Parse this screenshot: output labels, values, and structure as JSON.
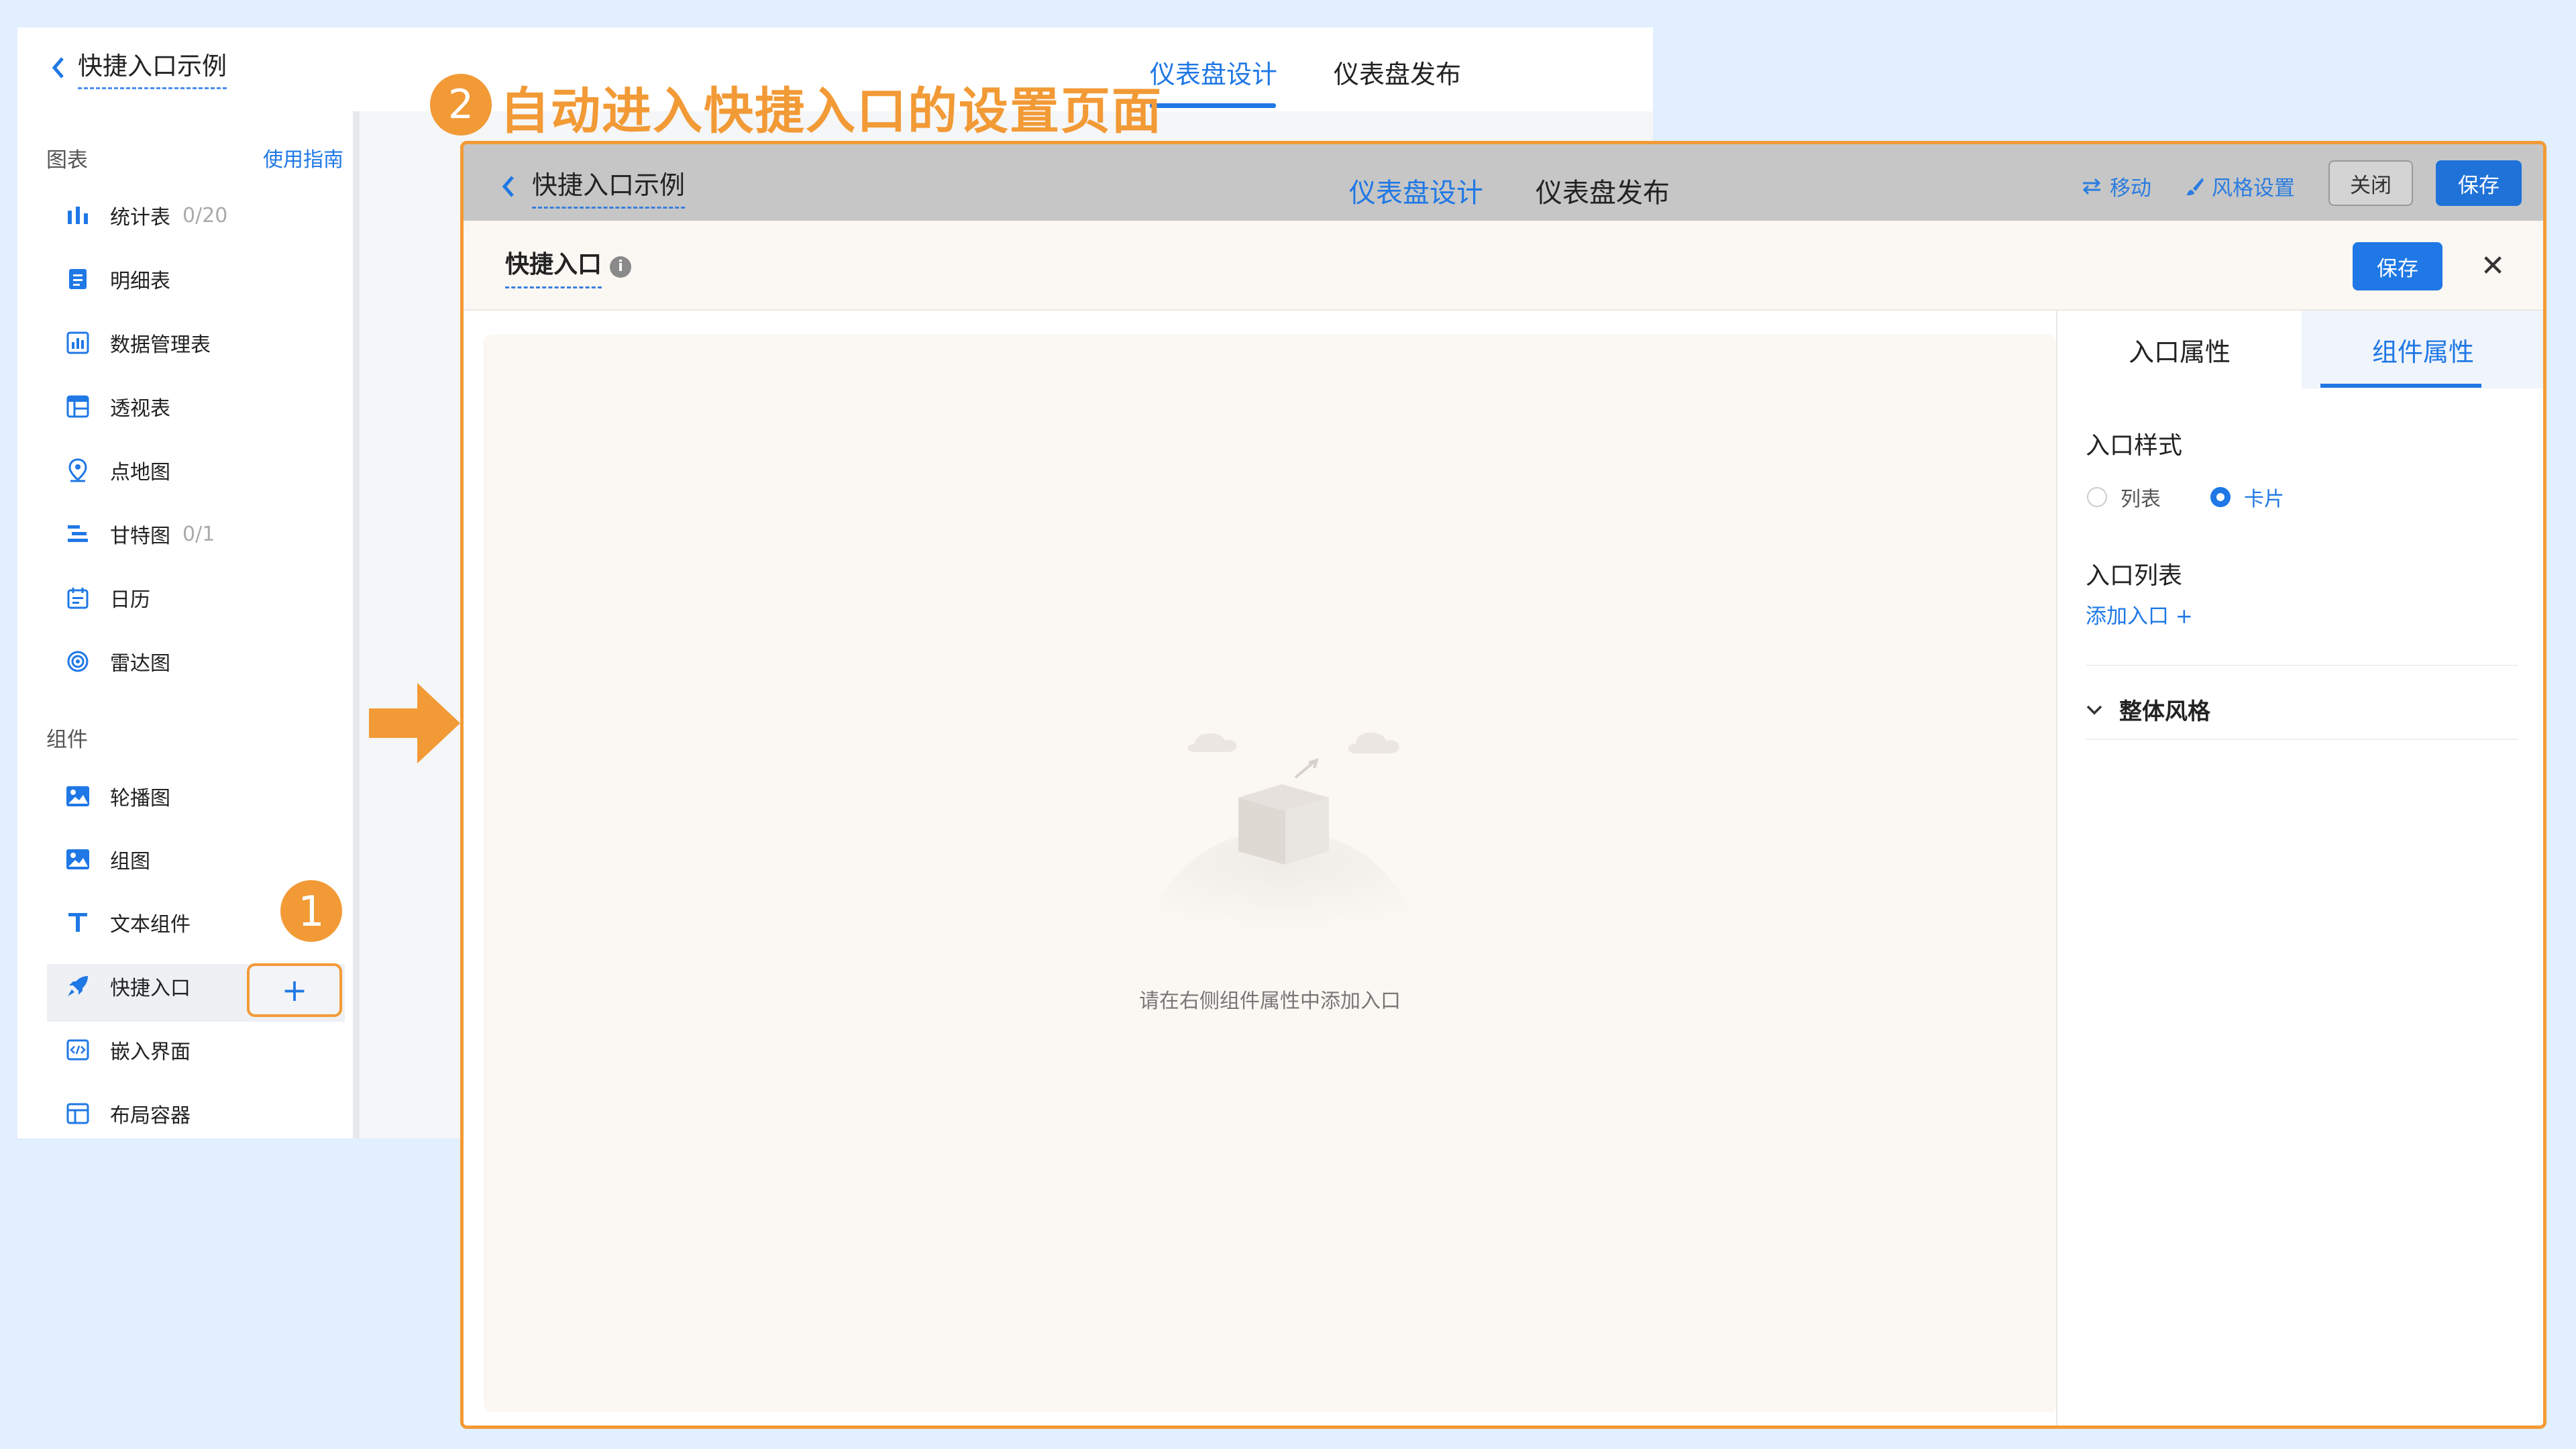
{
  "background": {
    "back_title": "快捷入口示例",
    "tabs": [
      "仪表盘设计",
      "仪表盘发布"
    ]
  },
  "sidebar": {
    "charts_title": "图表",
    "guide_link": "使用指南",
    "charts": [
      {
        "label": "统计表",
        "count": "0/20",
        "icon": "bar-chart-icon"
      },
      {
        "label": "明细表",
        "count": "",
        "icon": "detail-table-icon"
      },
      {
        "label": "数据管理表",
        "count": "",
        "icon": "data-manage-icon"
      },
      {
        "label": "透视表",
        "count": "",
        "icon": "pivot-table-icon"
      },
      {
        "label": "点地图",
        "count": "",
        "icon": "map-pin-icon"
      },
      {
        "label": "甘特图",
        "count": "0/1",
        "icon": "gantt-icon"
      },
      {
        "label": "日历",
        "count": "",
        "icon": "calendar-icon"
      },
      {
        "label": "雷达图",
        "count": "",
        "icon": "radar-icon"
      }
    ],
    "components_title": "组件",
    "components": [
      {
        "label": "轮播图",
        "icon": "image-icon"
      },
      {
        "label": "组图",
        "icon": "image-icon"
      },
      {
        "label": "文本组件",
        "icon": "text-icon"
      },
      {
        "label": "快捷入口",
        "icon": "rocket-icon"
      },
      {
        "label": "嵌入界面",
        "icon": "embed-code-icon"
      },
      {
        "label": "布局容器",
        "icon": "layout-icon"
      }
    ],
    "add_symbol": "+"
  },
  "annotations": {
    "step1": "1",
    "step2": "2",
    "step2_text": "自动进入快捷入口的设置页面",
    "accent": "#f29a36"
  },
  "front": {
    "back_title": "快捷入口示例",
    "tabs": [
      "仪表盘设计",
      "仪表盘发布"
    ],
    "move": "移动",
    "style_settings": "风格设置",
    "close": "关闭",
    "save": "保存"
  },
  "modal": {
    "title": "快捷入口",
    "save": "保存",
    "empty_text": "请在右侧组件属性中添加入口",
    "panel": {
      "tabs": [
        "入口属性",
        "组件属性"
      ],
      "active_tab": "组件属性",
      "entry_style_label": "入口样式",
      "style_options": [
        "列表",
        "卡片"
      ],
      "selected_style": "卡片",
      "entry_list_label": "入口列表",
      "add_entry": "添加入口 +",
      "overall_style": "整体风格"
    }
  },
  "colors": {
    "primary": "#1f78e5",
    "accent": "#f29a36"
  }
}
